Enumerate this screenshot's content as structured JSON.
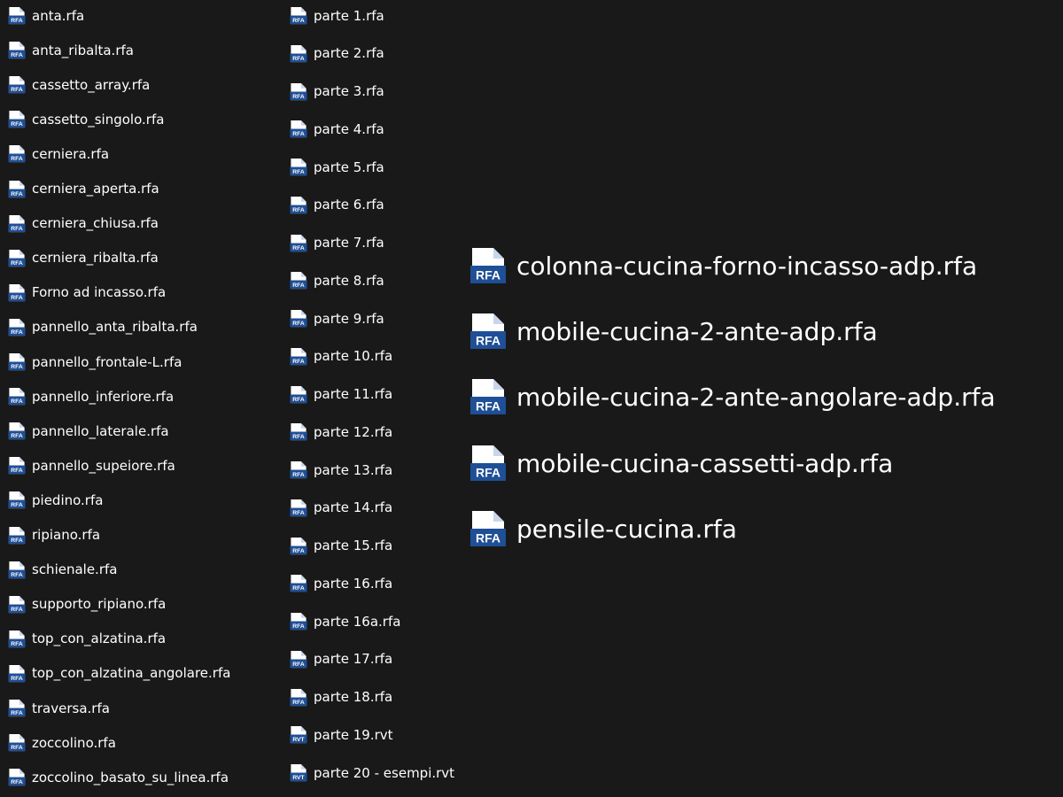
{
  "columns": [
    {
      "id": "col1",
      "icon_size": "small",
      "files": [
        {
          "name": "anta.rfa",
          "type": "RFA"
        },
        {
          "name": "anta_ribalta.rfa",
          "type": "RFA"
        },
        {
          "name": "cassetto_array.rfa",
          "type": "RFA"
        },
        {
          "name": "cassetto_singolo.rfa",
          "type": "RFA"
        },
        {
          "name": "cerniera.rfa",
          "type": "RFA"
        },
        {
          "name": "cerniera_aperta.rfa",
          "type": "RFA"
        },
        {
          "name": "cerniera_chiusa.rfa",
          "type": "RFA"
        },
        {
          "name": "cerniera_ribalta.rfa",
          "type": "RFA"
        },
        {
          "name": "Forno ad incasso.rfa",
          "type": "RFA"
        },
        {
          "name": "pannello_anta_ribalta.rfa",
          "type": "RFA"
        },
        {
          "name": "pannello_frontale-L.rfa",
          "type": "RFA"
        },
        {
          "name": "pannello_inferiore.rfa",
          "type": "RFA"
        },
        {
          "name": "pannello_laterale.rfa",
          "type": "RFA"
        },
        {
          "name": "pannello_supeiore.rfa",
          "type": "RFA"
        },
        {
          "name": "piedino.rfa",
          "type": "RFA"
        },
        {
          "name": "ripiano.rfa",
          "type": "RFA"
        },
        {
          "name": "schienale.rfa",
          "type": "RFA"
        },
        {
          "name": "supporto_ripiano.rfa",
          "type": "RFA"
        },
        {
          "name": "top_con_alzatina.rfa",
          "type": "RFA"
        },
        {
          "name": "top_con_alzatina_angolare.rfa",
          "type": "RFA"
        },
        {
          "name": "traversa.rfa",
          "type": "RFA"
        },
        {
          "name": "zoccolino.rfa",
          "type": "RFA"
        },
        {
          "name": "zoccolino_basato_su_linea.rfa",
          "type": "RFA"
        }
      ]
    },
    {
      "id": "col2",
      "icon_size": "small",
      "files": [
        {
          "name": "parte 1.rfa",
          "type": "RFA"
        },
        {
          "name": "parte 2.rfa",
          "type": "RFA"
        },
        {
          "name": "parte 3.rfa",
          "type": "RFA"
        },
        {
          "name": "parte 4.rfa",
          "type": "RFA"
        },
        {
          "name": "parte 5.rfa",
          "type": "RFA"
        },
        {
          "name": "parte 6.rfa",
          "type": "RFA"
        },
        {
          "name": "parte 7.rfa",
          "type": "RFA"
        },
        {
          "name": "parte 8.rfa",
          "type": "RFA"
        },
        {
          "name": "parte 9.rfa",
          "type": "RFA"
        },
        {
          "name": "parte 10.rfa",
          "type": "RFA"
        },
        {
          "name": "parte 11.rfa",
          "type": "RFA"
        },
        {
          "name": "parte 12.rfa",
          "type": "RFA"
        },
        {
          "name": "parte 13.rfa",
          "type": "RFA"
        },
        {
          "name": "parte 14.rfa",
          "type": "RFA"
        },
        {
          "name": "parte 15.rfa",
          "type": "RFA"
        },
        {
          "name": "parte 16.rfa",
          "type": "RFA"
        },
        {
          "name": "parte 16a.rfa",
          "type": "RFA"
        },
        {
          "name": "parte 17.rfa",
          "type": "RFA"
        },
        {
          "name": "parte 18.rfa",
          "type": "RFA"
        },
        {
          "name": "parte 19.rvt",
          "type": "RVT"
        },
        {
          "name": "parte 20 - esempi.rvt",
          "type": "RVT"
        }
      ]
    },
    {
      "id": "col3",
      "icon_size": "large",
      "files": [
        {
          "name": "colonna-cucina-forno-incasso-adp.rfa",
          "type": "RFA"
        },
        {
          "name": "mobile-cucina-2-ante-adp.rfa",
          "type": "RFA"
        },
        {
          "name": "mobile-cucina-2-ante-angolare-adp.rfa",
          "type": "RFA"
        },
        {
          "name": "mobile-cucina-cassetti-adp.rfa",
          "type": "RFA"
        },
        {
          "name": "pensile-cucina.rfa",
          "type": "RFA"
        }
      ]
    }
  ],
  "colors": {
    "background": "#191919",
    "text": "#ffffff",
    "icon_paper": "#ffffff",
    "icon_band": "#1f4f96"
  },
  "icon_names": {
    "RFA": "revit-family-file-icon",
    "RVT": "revit-project-file-icon"
  }
}
